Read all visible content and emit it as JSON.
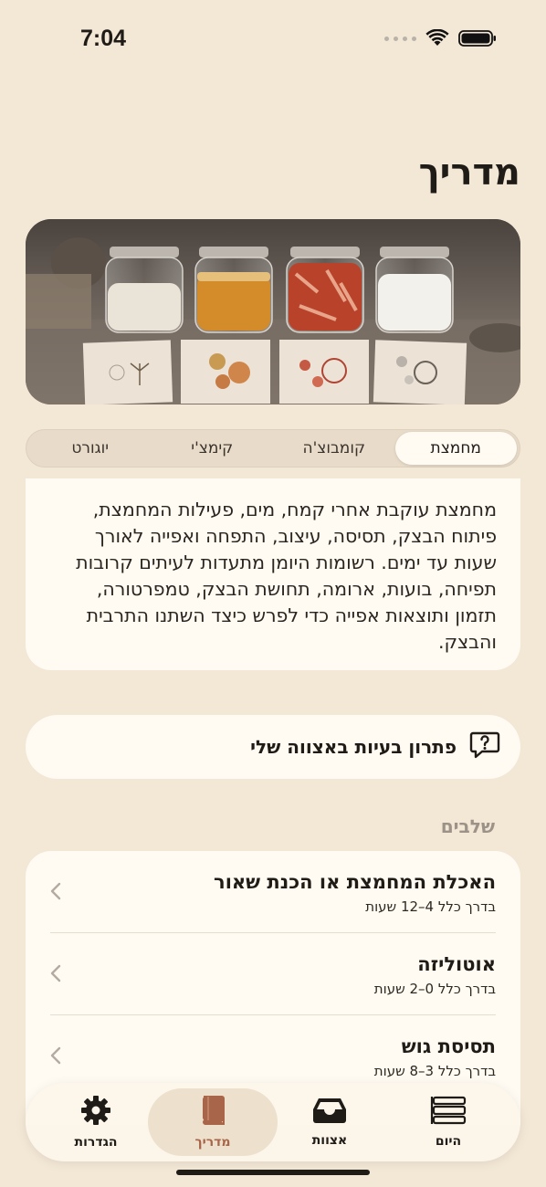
{
  "status": {
    "time": "7:04"
  },
  "page": {
    "title": "מדריך"
  },
  "hero": {
    "image_alt": "four-jars-hero-image"
  },
  "tabs": [
    {
      "label": "מחמצת",
      "active": true
    },
    {
      "label": "קומבוצ'ה",
      "active": false
    },
    {
      "label": "קימצ'י",
      "active": false
    },
    {
      "label": "יוגורט",
      "active": false
    }
  ],
  "description": {
    "line1": "מחמצת עוקבת אחרי קמח, מים, פעילות המחמצת,",
    "line2": "פיתוח הבצק, תסיסה, עיצוב, התפחה ואפייה לאורך",
    "line3": "שעות עד ימים. רשומות היומן מתעדות לעיתים קרובות",
    "line4": "תפיחה, בועות, ארומה, תחושת הבצק, טמפרטורה,",
    "line5": "תזמון ותוצאות אפייה כדי לפרש כיצד השתנו התרבית",
    "line6": "והבצק."
  },
  "troubleshoot": {
    "label": "פתרון בעיות באצווה שלי",
    "icon": "question-bubble-icon"
  },
  "stages_header": "שלבים",
  "stages": [
    {
      "title": "האכלת המחמצת או הכנת שאור",
      "subtitle": "בדרך כלל 4–12 שעות"
    },
    {
      "title": "אוטוליזה",
      "subtitle": "בדרך כלל 0–2 שעות"
    },
    {
      "title": "תסיסת גוש",
      "subtitle": "בדרך כלל 3–8 שעות"
    }
  ],
  "tabbar": [
    {
      "label": "היום",
      "icon": "list-icon",
      "active": false
    },
    {
      "label": "אצוות",
      "icon": "tray-icon",
      "active": false
    },
    {
      "label": "מדריך",
      "icon": "book-icon",
      "active": true
    },
    {
      "label": "הגדרות",
      "icon": "gear-icon",
      "active": false
    }
  ],
  "colors": {
    "background": "#f3e7d6",
    "card": "#fffaf2",
    "accent": "#a8654a"
  }
}
